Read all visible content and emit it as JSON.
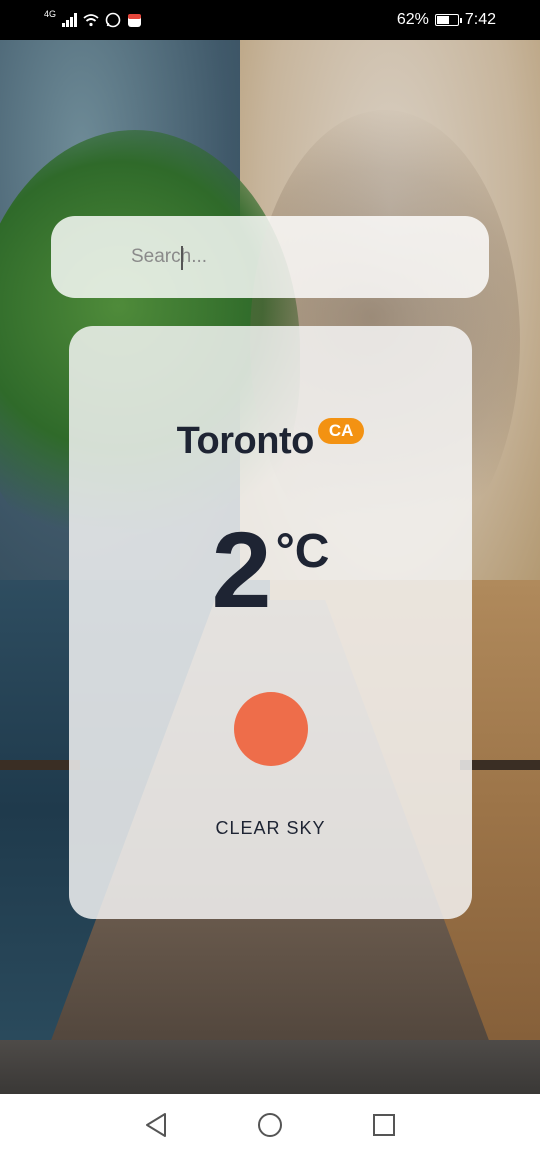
{
  "status_bar": {
    "network": "4G",
    "battery_percent": "62%",
    "battery_level": 0.62,
    "time": "7:42"
  },
  "search": {
    "placeholder": "Search..."
  },
  "weather": {
    "city": "Toronto",
    "country": "CA",
    "temperature": "2",
    "unit": "°C",
    "condition": "CLEAR SKY",
    "icon": "sun-icon",
    "icon_color": "#ee6d4a",
    "badge_color": "#f39212"
  },
  "nav": {
    "back": "back-icon",
    "home": "home-icon",
    "recents": "recents-icon"
  }
}
